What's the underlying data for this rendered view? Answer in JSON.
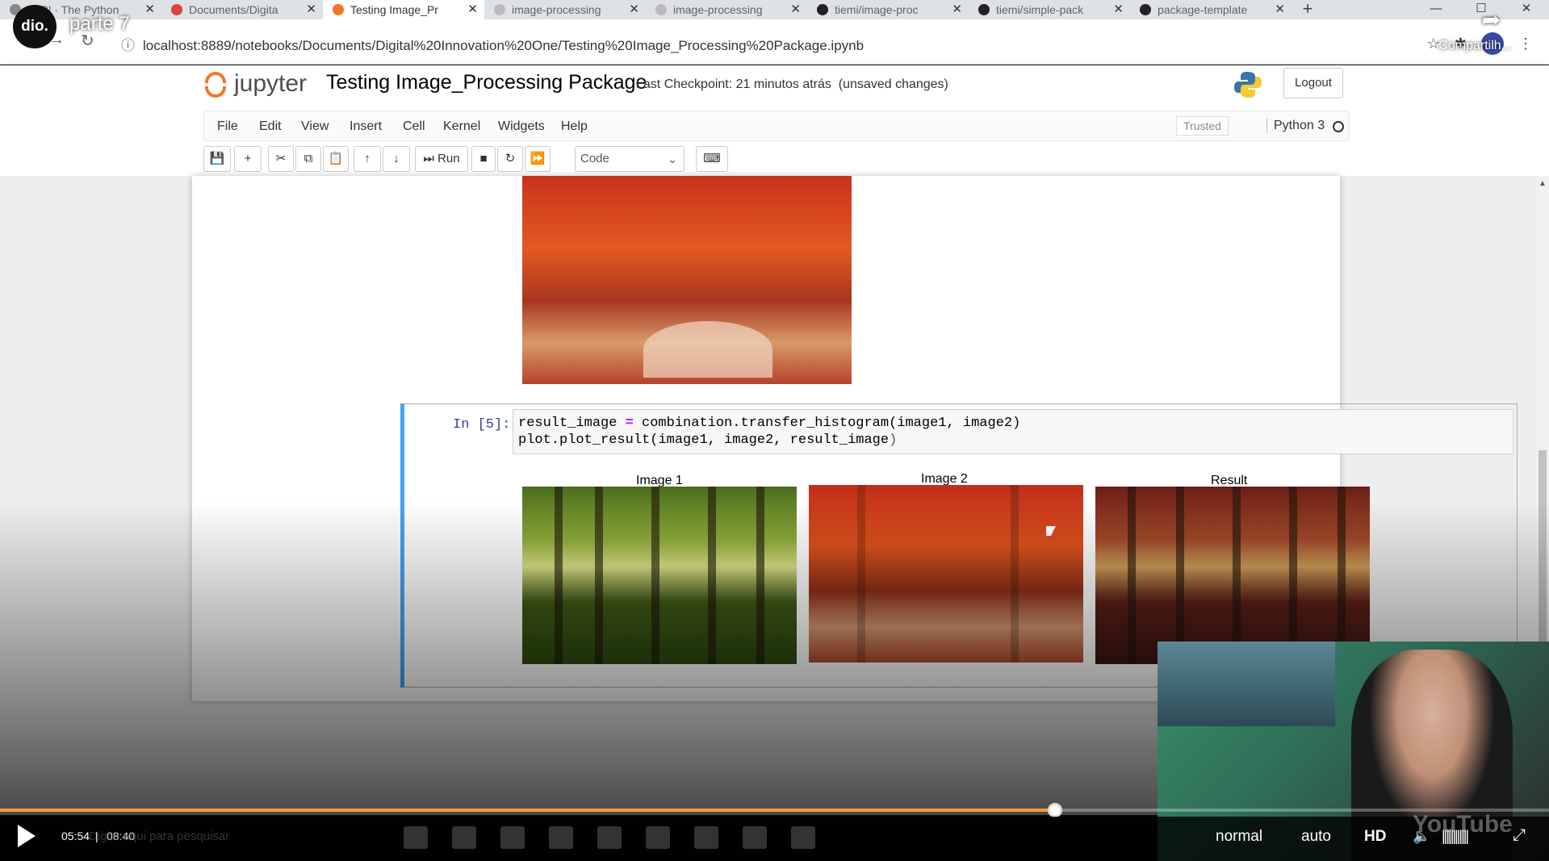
{
  "browser": {
    "tabs": [
      {
        "label": "PyPI · The Python",
        "active": false
      },
      {
        "label": "Documents/Digita",
        "active": false
      },
      {
        "label": "Testing Image_Pr",
        "active": true
      },
      {
        "label": "image-processing",
        "active": false
      },
      {
        "label": "image-processing",
        "active": false
      },
      {
        "label": "tiemi/image-proc",
        "active": false
      },
      {
        "label": "tiemi/simple-pack",
        "active": false
      },
      {
        "label": "package-template",
        "active": false
      }
    ],
    "new_tab": "+",
    "url": "localhost:8889/notebooks/Documents/Digital%20Innovation%20One/Testing%20Image_Processing%20Package.ipynb"
  },
  "video_overlay": {
    "channel_logo": "dio.",
    "title": "parte 7",
    "share_label": "Compartilh..."
  },
  "jupyter": {
    "logo_text": "jupyter",
    "notebook_title": "Testing Image_Processing Package",
    "checkpoint": "Last Checkpoint: 21 minutos atrás",
    "unsaved": "(unsaved changes)",
    "logout_label": "Logout",
    "menu": [
      "File",
      "Edit",
      "View",
      "Insert",
      "Cell",
      "Kernel",
      "Widgets",
      "Help"
    ],
    "trusted_label": "Trusted",
    "kernel_name": "Python 3",
    "toolbar": {
      "run_label": "Run",
      "cell_type": "Code"
    }
  },
  "cell": {
    "prompt": "In [5]:",
    "code_line1_a": "result_image ",
    "code_line1_op": "=",
    "code_line1_b": " combination.transfer_histogram(image1, image2)",
    "code_line2_a": "plot.plot_result",
    "code_line2_b": "(image1, image2, result_image",
    "code_line2_c": ")",
    "figure_titles": [
      "Image 1",
      "Image 2",
      "Result"
    ]
  },
  "player": {
    "current_time": "05:54",
    "separator": "|",
    "total_time": "08:40",
    "progress": 0.681,
    "taskbar_search": "Digite aqui para pesquisar",
    "speed": "normal",
    "quality_auto": "auto",
    "quality_hd": "HD",
    "watermark": "YouTube"
  }
}
